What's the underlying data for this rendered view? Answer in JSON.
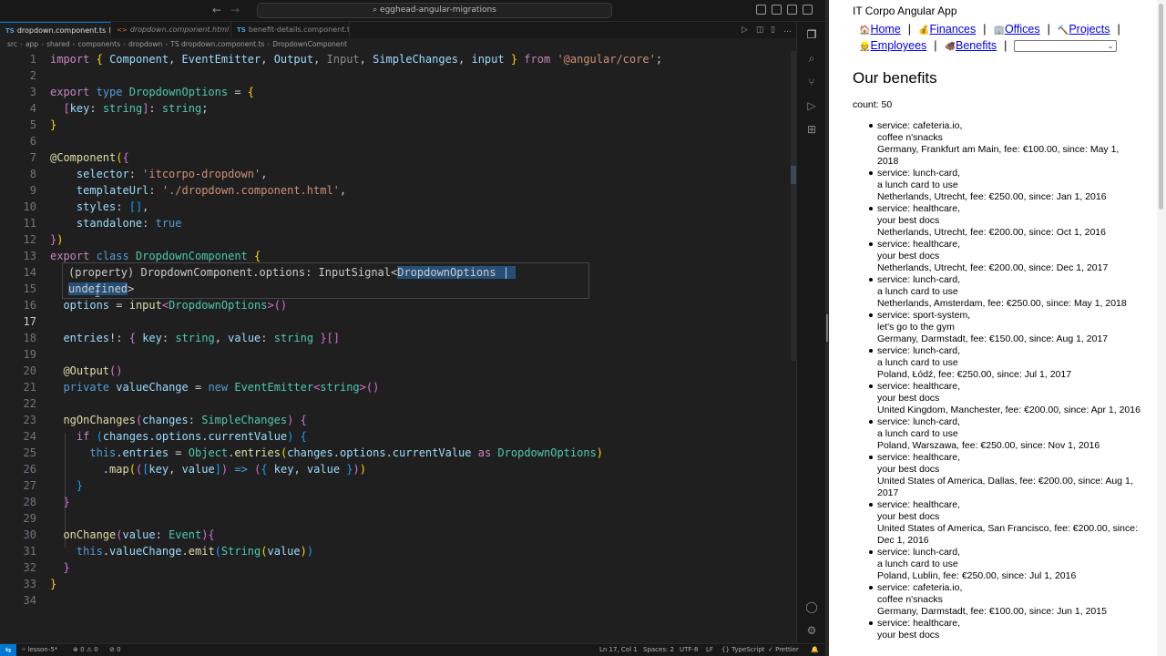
{
  "vscode": {
    "command_center": "egghead-angular-migrations",
    "tabs": [
      {
        "type": "TS",
        "label": "dropdown.component.ts",
        "modified": "M",
        "active": true
      },
      {
        "type": "<>",
        "label": "dropdown.component.html",
        "modified": "",
        "active": false
      },
      {
        "type": "TS",
        "label": "benefit-details.component.ts",
        "modified": "",
        "active": false
      }
    ],
    "breadcrumb": [
      "src",
      "app",
      "shared",
      "components",
      "dropdown",
      "TS dropdown.component.ts",
      "DropdownComponent"
    ],
    "hover": {
      "line1_prefix": "(property) DropdownComponent.options: InputSignal<",
      "line1_selected": "DropdownOptions | ",
      "line2_selected": "undefined",
      "line2_suffix": ">"
    },
    "status": {
      "branch": "lesson-5*",
      "errors": "0",
      "warnings": "0",
      "ports": "0",
      "position": "Ln 17, Col 1",
      "spaces": "Spaces: 2",
      "encoding": "UTF-8",
      "eol": "LF",
      "language": "TypeScript",
      "formatter": "Prettier"
    }
  },
  "browser": {
    "app_title": "IT Corpo Angular App",
    "nav": [
      {
        "icon": "🏠",
        "label": "Home"
      },
      {
        "icon": "💰",
        "label": "Finances"
      },
      {
        "icon": "🏢",
        "label": "Offices"
      },
      {
        "icon": "🔨",
        "label": "Projects"
      },
      {
        "icon": "👷",
        "label": "Employees"
      },
      {
        "icon": "🐗",
        "label": "Benefits"
      }
    ],
    "heading": "Our benefits",
    "count": "count: 50",
    "benefits": [
      {
        "service": "service: cafeteria.io,",
        "desc": "coffee n'snacks",
        "detail": "Germany, Frankfurt am Main, fee: €100.00, since: May 1, 2018"
      },
      {
        "service": "service: lunch-card,",
        "desc": "a lunch card to use",
        "detail": "Netherlands, Utrecht, fee: €250.00, since: Jan 1, 2016"
      },
      {
        "service": "service: healthcare,",
        "desc": "your best docs",
        "detail": "Netherlands, Utrecht, fee: €200.00, since: Oct 1, 2016"
      },
      {
        "service": "service: healthcare,",
        "desc": "your best docs",
        "detail": "Netherlands, Utrecht, fee: €200.00, since: Dec 1, 2017"
      },
      {
        "service": "service: lunch-card,",
        "desc": "a lunch card to use",
        "detail": "Netherlands, Amsterdam, fee: €250.00, since: May 1, 2018"
      },
      {
        "service": "service: sport-system,",
        "desc": "let's go to the gym",
        "detail": "Germany, Darmstadt, fee: €150.00, since: Aug 1, 2017"
      },
      {
        "service": "service: lunch-card,",
        "desc": "a lunch card to use",
        "detail": "Poland, Łódź, fee: €250.00, since: Jul 1, 2017"
      },
      {
        "service": "service: healthcare,",
        "desc": "your best docs",
        "detail": "United Kingdom, Manchester, fee: €200.00, since: Apr 1, 2016"
      },
      {
        "service": "service: lunch-card,",
        "desc": "a lunch card to use",
        "detail": "Poland, Warszawa, fee: €250.00, since: Nov 1, 2016"
      },
      {
        "service": "service: healthcare,",
        "desc": "your best docs",
        "detail": "United States of America, Dallas, fee: €200.00, since: Aug 1, 2017"
      },
      {
        "service": "service: healthcare,",
        "desc": "your best docs",
        "detail": "United States of America, San Francisco, fee: €200.00, since: Dec 1, 2016"
      },
      {
        "service": "service: lunch-card,",
        "desc": "a lunch card to use",
        "detail": "Poland, Lublin, fee: €250.00, since: Jul 1, 2016"
      },
      {
        "service": "service: cafeteria.io,",
        "desc": "coffee n'snacks",
        "detail": "Germany, Darmstadt, fee: €100.00, since: Jun 1, 2015"
      },
      {
        "service": "service: healthcare,",
        "desc": "your best docs",
        "detail": ""
      }
    ]
  }
}
